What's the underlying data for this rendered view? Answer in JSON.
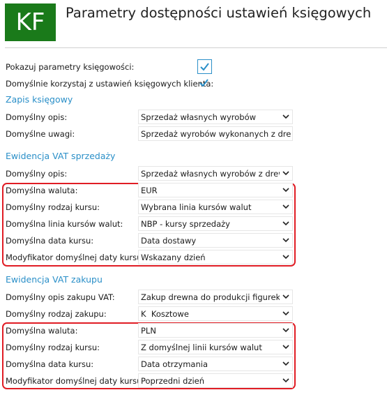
{
  "header": {
    "logo_text": "KF",
    "title": "Parametry dostępności ustawień księgowych",
    "logo_color": "#1a7a1a"
  },
  "general": {
    "show_params_label": "Pokazuj parametry księgowości:",
    "show_params_checked": true,
    "use_client_label": "Domyślnie korzystaj z ustawień księgowych klienta:",
    "use_client_checked": true
  },
  "zapis": {
    "section_title": "Zapis księgowy",
    "desc_label": "Domyślny opis:",
    "desc_value": "Sprzedaż własnych wyrobów",
    "notes_label": "Domyślne uwagi:",
    "notes_value": "Sprzedaż wyrobów wykonanych z drewna"
  },
  "vat_sale": {
    "section_title": "Ewidencja VAT sprzedaży",
    "desc_label": "Domyślny opis:",
    "desc_value": "Sprzedaż własnych wyrobów z drewna",
    "currency_label": "Domyślna waluta:",
    "currency_value": "EUR",
    "rate_type_label": "Domyślny rodzaj kursu:",
    "rate_type_value": "Wybrana linia kursów walut",
    "rate_line_label": "Domyślna linia kursów walut:",
    "rate_line_value": "NBP - kursy sprzedaży",
    "rate_date_label": "Domyślna data kursu:",
    "rate_date_value": "Data dostawy",
    "date_mod_label": "Modyfikator domyślnej daty kursu:",
    "date_mod_value": "Wskazany dzień"
  },
  "vat_purchase": {
    "section_title": "Ewidencja VAT zakupu",
    "desc_label": "Domyślny opis zakupu VAT:",
    "desc_value": "Zakup drewna do produkcji figurek",
    "purchase_type_label": "Domyślny rodzaj zakupu:",
    "purchase_type_value": "K  Kosztowe",
    "currency_label": "Domyślna waluta:",
    "currency_value": "PLN",
    "rate_type_label": "Domyślny rodzaj kursu:",
    "rate_type_value": "Z domyślnej linii kursów walut",
    "rate_date_label": "Domyślna data kursu:",
    "rate_date_value": "Data otrzymania",
    "date_mod_label": "Modyfikator domyślnej daty kursu:",
    "date_mod_value": "Poprzedni dzień"
  },
  "colors": {
    "accent": "#2a8fc8",
    "highlight_border": "#e01c24"
  }
}
